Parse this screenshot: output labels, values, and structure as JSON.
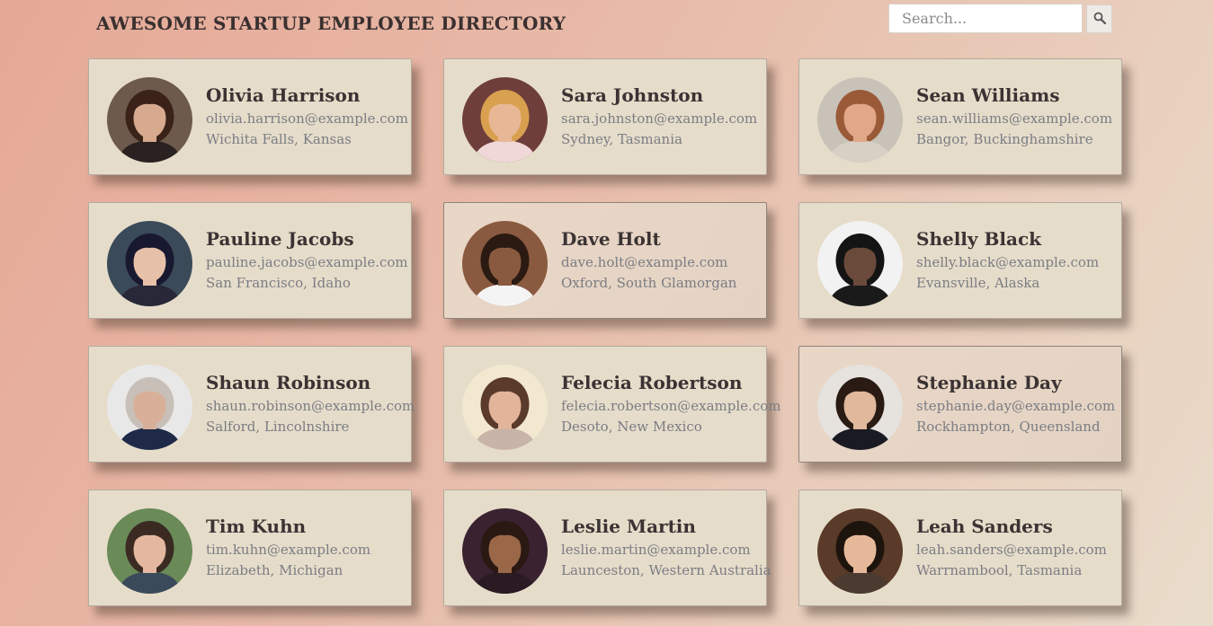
{
  "header": {
    "title": "AWESOME STARTUP EMPLOYEE DIRECTORY",
    "search_placeholder": "Search...",
    "search_icon": "magnifier-icon"
  },
  "employees": [
    {
      "name": "Olivia Harrison",
      "email": "olivia.harrison@example.com",
      "location": "Wichita Falls, Kansas",
      "avatar": {
        "bg": "#6d5a4c",
        "skin": "#d7aa90",
        "hair": "#3a2218",
        "shirt": "#2a2220"
      }
    },
    {
      "name": "Sara Johnston",
      "email": "sara.johnston@example.com",
      "location": "Sydney, Tasmania",
      "avatar": {
        "bg": "#6e3f3a",
        "skin": "#e8b896",
        "hair": "#d9a050",
        "shirt": "#f0d8d8"
      }
    },
    {
      "name": "Sean Williams",
      "email": "sean.williams@example.com",
      "location": "Bangor, Buckinghamshire",
      "avatar": {
        "bg": "#c8c2b8",
        "skin": "#e0a888",
        "hair": "#9a5a38",
        "shirt": "#d8d0c4"
      }
    },
    {
      "name": "Pauline Jacobs",
      "email": "pauline.jacobs@example.com",
      "location": "San Francisco, Idaho",
      "avatar": {
        "bg": "#3a4a58",
        "skin": "#e6c0a8",
        "hair": "#181830",
        "shirt": "#282838"
      }
    },
    {
      "name": "Dave Holt",
      "email": "dave.holt@example.com",
      "location": "Oxford, South Glamorgan",
      "avatar": {
        "bg": "#8a5a40",
        "skin": "#8a5a40",
        "hair": "#2a1a12",
        "shirt": "#f4f4f4"
      }
    },
    {
      "name": "Shelly Black",
      "email": "shelly.black@example.com",
      "location": "Evansville, Alaska",
      "avatar": {
        "bg": "#f2f2f2",
        "skin": "#6a4a3a",
        "hair": "#141414",
        "shirt": "#1a1a1a"
      }
    },
    {
      "name": "Shaun Robinson",
      "email": "shaun.robinson@example.com",
      "location": "Salford, Lincolnshire",
      "avatar": {
        "bg": "#e8e8e8",
        "skin": "#d8b09a",
        "hair": "#c8c0b8",
        "shirt": "#1e2a48"
      }
    },
    {
      "name": "Felecia Robertson",
      "email": "felecia.robertson@example.com",
      "location": "Desoto, New Mexico",
      "avatar": {
        "bg": "#f2e8d0",
        "skin": "#e2b49a",
        "hair": "#5a3a2a",
        "shirt": "#c8b4a8"
      }
    },
    {
      "name": "Stephanie Day",
      "email": "stephanie.day@example.com",
      "location": "Rockhampton, Queensland",
      "avatar": {
        "bg": "#e6e2de",
        "skin": "#e0b89c",
        "hair": "#2a1a14",
        "shirt": "#1a1a22"
      }
    },
    {
      "name": "Tim Kuhn",
      "email": "tim.kuhn@example.com",
      "location": "Elizabeth, Michigan",
      "avatar": {
        "bg": "#6a8a58",
        "skin": "#e4b8a0",
        "hair": "#3a2a22",
        "shirt": "#3a4a5a"
      }
    },
    {
      "name": "Leslie Martin",
      "email": "leslie.martin@example.com",
      "location": "Launceston, Western Australia",
      "avatar": {
        "bg": "#3a2230",
        "skin": "#9a6848",
        "hair": "#2a1812",
        "shirt": "#2a1a22"
      }
    },
    {
      "name": "Leah Sanders",
      "email": "leah.sanders@example.com",
      "location": "Warrnambool, Tasmania",
      "avatar": {
        "bg": "#5a3a28",
        "skin": "#e6b89a",
        "hair": "#1e140e",
        "shirt": "#4a3a30"
      }
    }
  ]
}
